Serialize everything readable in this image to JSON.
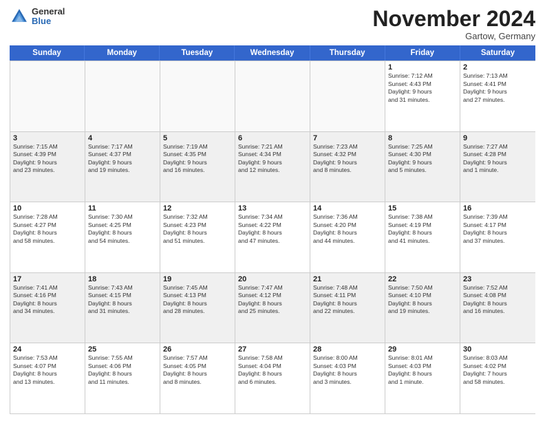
{
  "header": {
    "logo": {
      "general": "General",
      "blue": "Blue"
    },
    "title": "November 2024",
    "location": "Gartow, Germany"
  },
  "weekdays": [
    "Sunday",
    "Monday",
    "Tuesday",
    "Wednesday",
    "Thursday",
    "Friday",
    "Saturday"
  ],
  "weeks": [
    [
      {
        "day": "",
        "info": ""
      },
      {
        "day": "",
        "info": ""
      },
      {
        "day": "",
        "info": ""
      },
      {
        "day": "",
        "info": ""
      },
      {
        "day": "",
        "info": ""
      },
      {
        "day": "1",
        "info": "Sunrise: 7:12 AM\nSunset: 4:43 PM\nDaylight: 9 hours\nand 31 minutes."
      },
      {
        "day": "2",
        "info": "Sunrise: 7:13 AM\nSunset: 4:41 PM\nDaylight: 9 hours\nand 27 minutes."
      }
    ],
    [
      {
        "day": "3",
        "info": "Sunrise: 7:15 AM\nSunset: 4:39 PM\nDaylight: 9 hours\nand 23 minutes."
      },
      {
        "day": "4",
        "info": "Sunrise: 7:17 AM\nSunset: 4:37 PM\nDaylight: 9 hours\nand 19 minutes."
      },
      {
        "day": "5",
        "info": "Sunrise: 7:19 AM\nSunset: 4:35 PM\nDaylight: 9 hours\nand 16 minutes."
      },
      {
        "day": "6",
        "info": "Sunrise: 7:21 AM\nSunset: 4:34 PM\nDaylight: 9 hours\nand 12 minutes."
      },
      {
        "day": "7",
        "info": "Sunrise: 7:23 AM\nSunset: 4:32 PM\nDaylight: 9 hours\nand 8 minutes."
      },
      {
        "day": "8",
        "info": "Sunrise: 7:25 AM\nSunset: 4:30 PM\nDaylight: 9 hours\nand 5 minutes."
      },
      {
        "day": "9",
        "info": "Sunrise: 7:27 AM\nSunset: 4:28 PM\nDaylight: 9 hours\nand 1 minute."
      }
    ],
    [
      {
        "day": "10",
        "info": "Sunrise: 7:28 AM\nSunset: 4:27 PM\nDaylight: 8 hours\nand 58 minutes."
      },
      {
        "day": "11",
        "info": "Sunrise: 7:30 AM\nSunset: 4:25 PM\nDaylight: 8 hours\nand 54 minutes."
      },
      {
        "day": "12",
        "info": "Sunrise: 7:32 AM\nSunset: 4:23 PM\nDaylight: 8 hours\nand 51 minutes."
      },
      {
        "day": "13",
        "info": "Sunrise: 7:34 AM\nSunset: 4:22 PM\nDaylight: 8 hours\nand 47 minutes."
      },
      {
        "day": "14",
        "info": "Sunrise: 7:36 AM\nSunset: 4:20 PM\nDaylight: 8 hours\nand 44 minutes."
      },
      {
        "day": "15",
        "info": "Sunrise: 7:38 AM\nSunset: 4:19 PM\nDaylight: 8 hours\nand 41 minutes."
      },
      {
        "day": "16",
        "info": "Sunrise: 7:39 AM\nSunset: 4:17 PM\nDaylight: 8 hours\nand 37 minutes."
      }
    ],
    [
      {
        "day": "17",
        "info": "Sunrise: 7:41 AM\nSunset: 4:16 PM\nDaylight: 8 hours\nand 34 minutes."
      },
      {
        "day": "18",
        "info": "Sunrise: 7:43 AM\nSunset: 4:15 PM\nDaylight: 8 hours\nand 31 minutes."
      },
      {
        "day": "19",
        "info": "Sunrise: 7:45 AM\nSunset: 4:13 PM\nDaylight: 8 hours\nand 28 minutes."
      },
      {
        "day": "20",
        "info": "Sunrise: 7:47 AM\nSunset: 4:12 PM\nDaylight: 8 hours\nand 25 minutes."
      },
      {
        "day": "21",
        "info": "Sunrise: 7:48 AM\nSunset: 4:11 PM\nDaylight: 8 hours\nand 22 minutes."
      },
      {
        "day": "22",
        "info": "Sunrise: 7:50 AM\nSunset: 4:10 PM\nDaylight: 8 hours\nand 19 minutes."
      },
      {
        "day": "23",
        "info": "Sunrise: 7:52 AM\nSunset: 4:08 PM\nDaylight: 8 hours\nand 16 minutes."
      }
    ],
    [
      {
        "day": "24",
        "info": "Sunrise: 7:53 AM\nSunset: 4:07 PM\nDaylight: 8 hours\nand 13 minutes."
      },
      {
        "day": "25",
        "info": "Sunrise: 7:55 AM\nSunset: 4:06 PM\nDaylight: 8 hours\nand 11 minutes."
      },
      {
        "day": "26",
        "info": "Sunrise: 7:57 AM\nSunset: 4:05 PM\nDaylight: 8 hours\nand 8 minutes."
      },
      {
        "day": "27",
        "info": "Sunrise: 7:58 AM\nSunset: 4:04 PM\nDaylight: 8 hours\nand 6 minutes."
      },
      {
        "day": "28",
        "info": "Sunrise: 8:00 AM\nSunset: 4:03 PM\nDaylight: 8 hours\nand 3 minutes."
      },
      {
        "day": "29",
        "info": "Sunrise: 8:01 AM\nSunset: 4:03 PM\nDaylight: 8 hours\nand 1 minute."
      },
      {
        "day": "30",
        "info": "Sunrise: 8:03 AM\nSunset: 4:02 PM\nDaylight: 7 hours\nand 58 minutes."
      }
    ]
  ]
}
